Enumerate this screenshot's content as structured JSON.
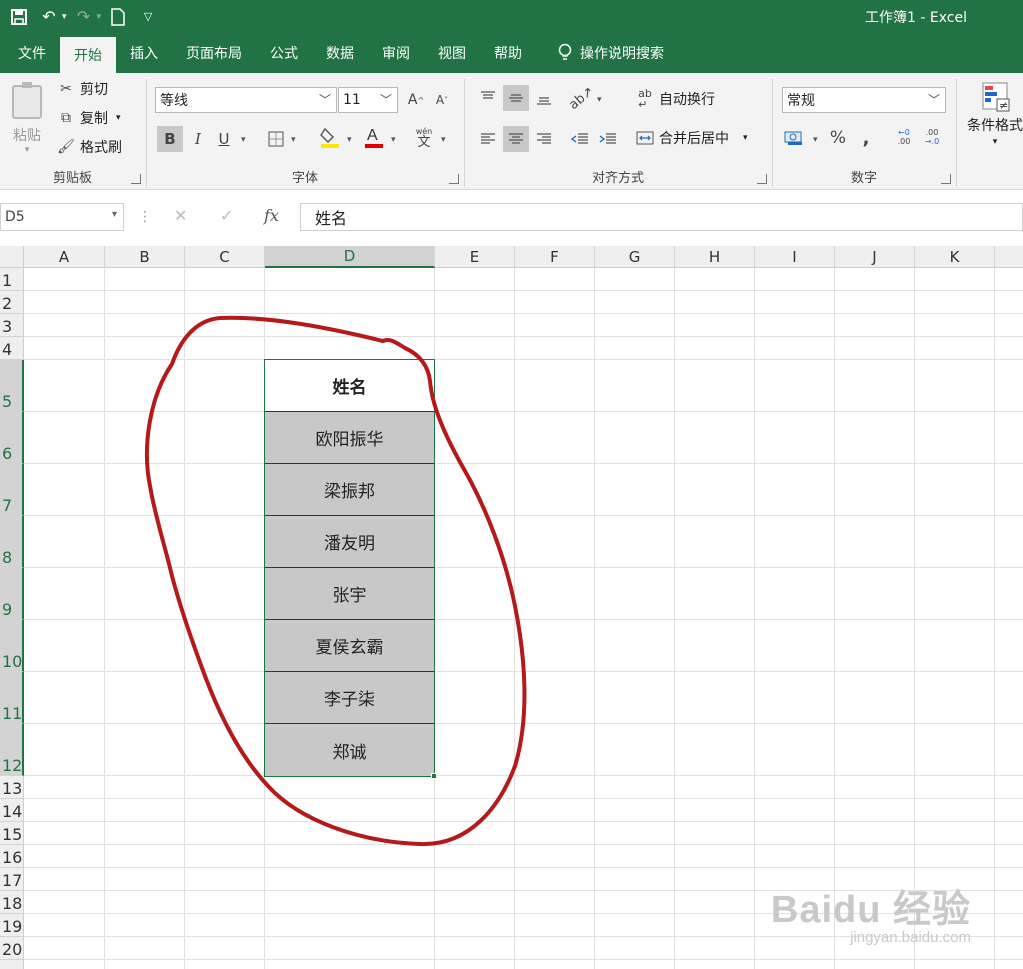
{
  "window": {
    "title": "工作簿1  -  Excel"
  },
  "qat": {
    "save_icon": "save-icon",
    "undo_icon": "undo-icon",
    "redo_icon": "redo-icon",
    "new_icon": "new-document-icon",
    "customize_icon": "customize-qat-icon"
  },
  "tabs": [
    {
      "label": "文件"
    },
    {
      "label": "开始"
    },
    {
      "label": "插入"
    },
    {
      "label": "页面布局"
    },
    {
      "label": "公式"
    },
    {
      "label": "数据"
    },
    {
      "label": "审阅"
    },
    {
      "label": "视图"
    },
    {
      "label": "帮助"
    }
  ],
  "tell_me": "操作说明搜索",
  "clipboard": {
    "label": "剪贴板",
    "paste": "粘贴",
    "cut": "剪切",
    "copy": "复制",
    "format_painter": "格式刷"
  },
  "font": {
    "label": "字体",
    "name": "等线",
    "size": "11",
    "bold": "B",
    "italic": "I",
    "underline": "U",
    "phonetic_top": "wén",
    "phonetic_bottom": "文"
  },
  "alignment": {
    "label": "对齐方式",
    "wrap_text": "自动换行",
    "merge_center": "合并后居中"
  },
  "number": {
    "label": "数字",
    "format": "常规",
    "percent": "%",
    "comma": ",",
    "inc_decimal_top": "←0",
    "inc_decimal_bottom": ".00",
    "dec_decimal_top": ".00",
    "dec_decimal_bottom": "→.0"
  },
  "styles": {
    "conditional_formatting": "条件格式"
  },
  "formula_bar": {
    "name_box": "D5",
    "content": "姓名",
    "fx": "fx"
  },
  "columns": [
    "A",
    "B",
    "C",
    "D",
    "E",
    "F",
    "G",
    "H",
    "I",
    "J",
    "K"
  ],
  "rows": [
    "1",
    "2",
    "3",
    "4",
    "5",
    "6",
    "7",
    "8",
    "9",
    "10",
    "11",
    "12",
    "13",
    "14",
    "15",
    "16",
    "17",
    "18",
    "19",
    "20"
  ],
  "table": {
    "header": "姓名",
    "names": [
      "欧阳振华",
      "梁振邦",
      "潘友明",
      "张宇",
      "夏侯玄霸",
      "李子柒",
      "郑诚"
    ]
  },
  "selection": {
    "active_cell": "D5"
  },
  "watermark": {
    "line1": "Baidu 经验",
    "line2": "jingyan.baidu.com"
  },
  "colors": {
    "excel_green": "#217346",
    "annotation_red": "#b5191a",
    "selected_fill": "#c8c8c8"
  }
}
